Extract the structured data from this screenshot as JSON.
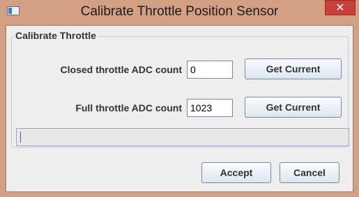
{
  "window": {
    "title": "Calibrate Throttle Position Sensor",
    "close_glyph": "✕",
    "icon": "app-window-icon"
  },
  "group": {
    "label": "Calibrate Throttle"
  },
  "closed_throttle": {
    "label": "Closed throttle ADC count",
    "value": "0",
    "button": "Get Current"
  },
  "full_throttle": {
    "label": "Full throttle ADC count",
    "value": "1023",
    "button": "Get Current"
  },
  "status": {
    "text": ""
  },
  "actions": {
    "accept": "Accept",
    "cancel": "Cancel"
  },
  "colors": {
    "titlebar": "#d4a083",
    "close_button": "#c7413a",
    "panel": "#eeeeee",
    "group_border": "#b8cfe5"
  }
}
